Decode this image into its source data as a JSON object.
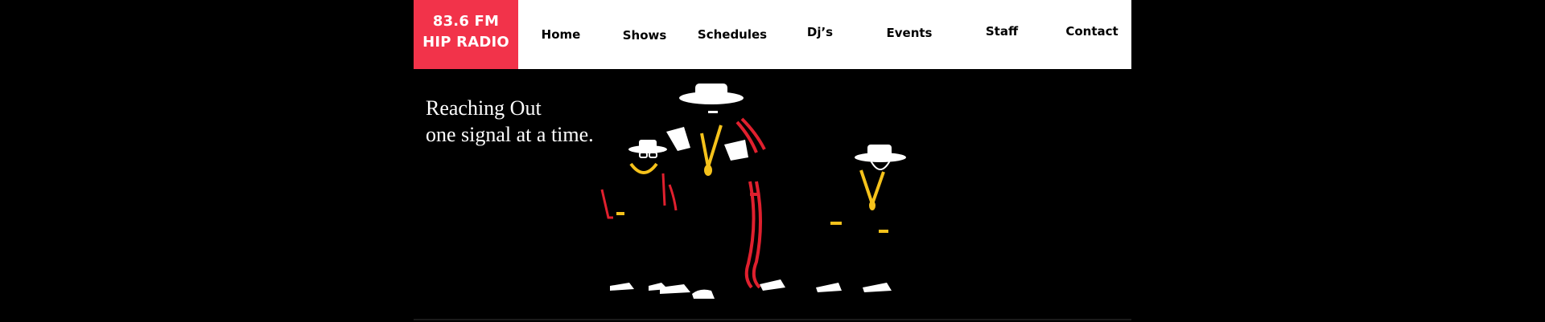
{
  "brand": {
    "line1": "83.6 FM",
    "line2": "HIP RADIO",
    "accent_color": "#f2334a"
  },
  "nav": {
    "home": "Home",
    "shows": "Shows",
    "schedules": "Schedules",
    "djs": "Dj’s",
    "events": "Events",
    "staff": "Staff",
    "contact": "Contact"
  },
  "hero": {
    "tagline_line1": "Reaching Out",
    "tagline_line2": "one signal at a time.",
    "illustration": "three-hip-hop-figures-illustration"
  },
  "colors": {
    "background": "#000000",
    "header_bg": "#ffffff",
    "gold": "#f5c21b",
    "red": "#e0202e"
  }
}
